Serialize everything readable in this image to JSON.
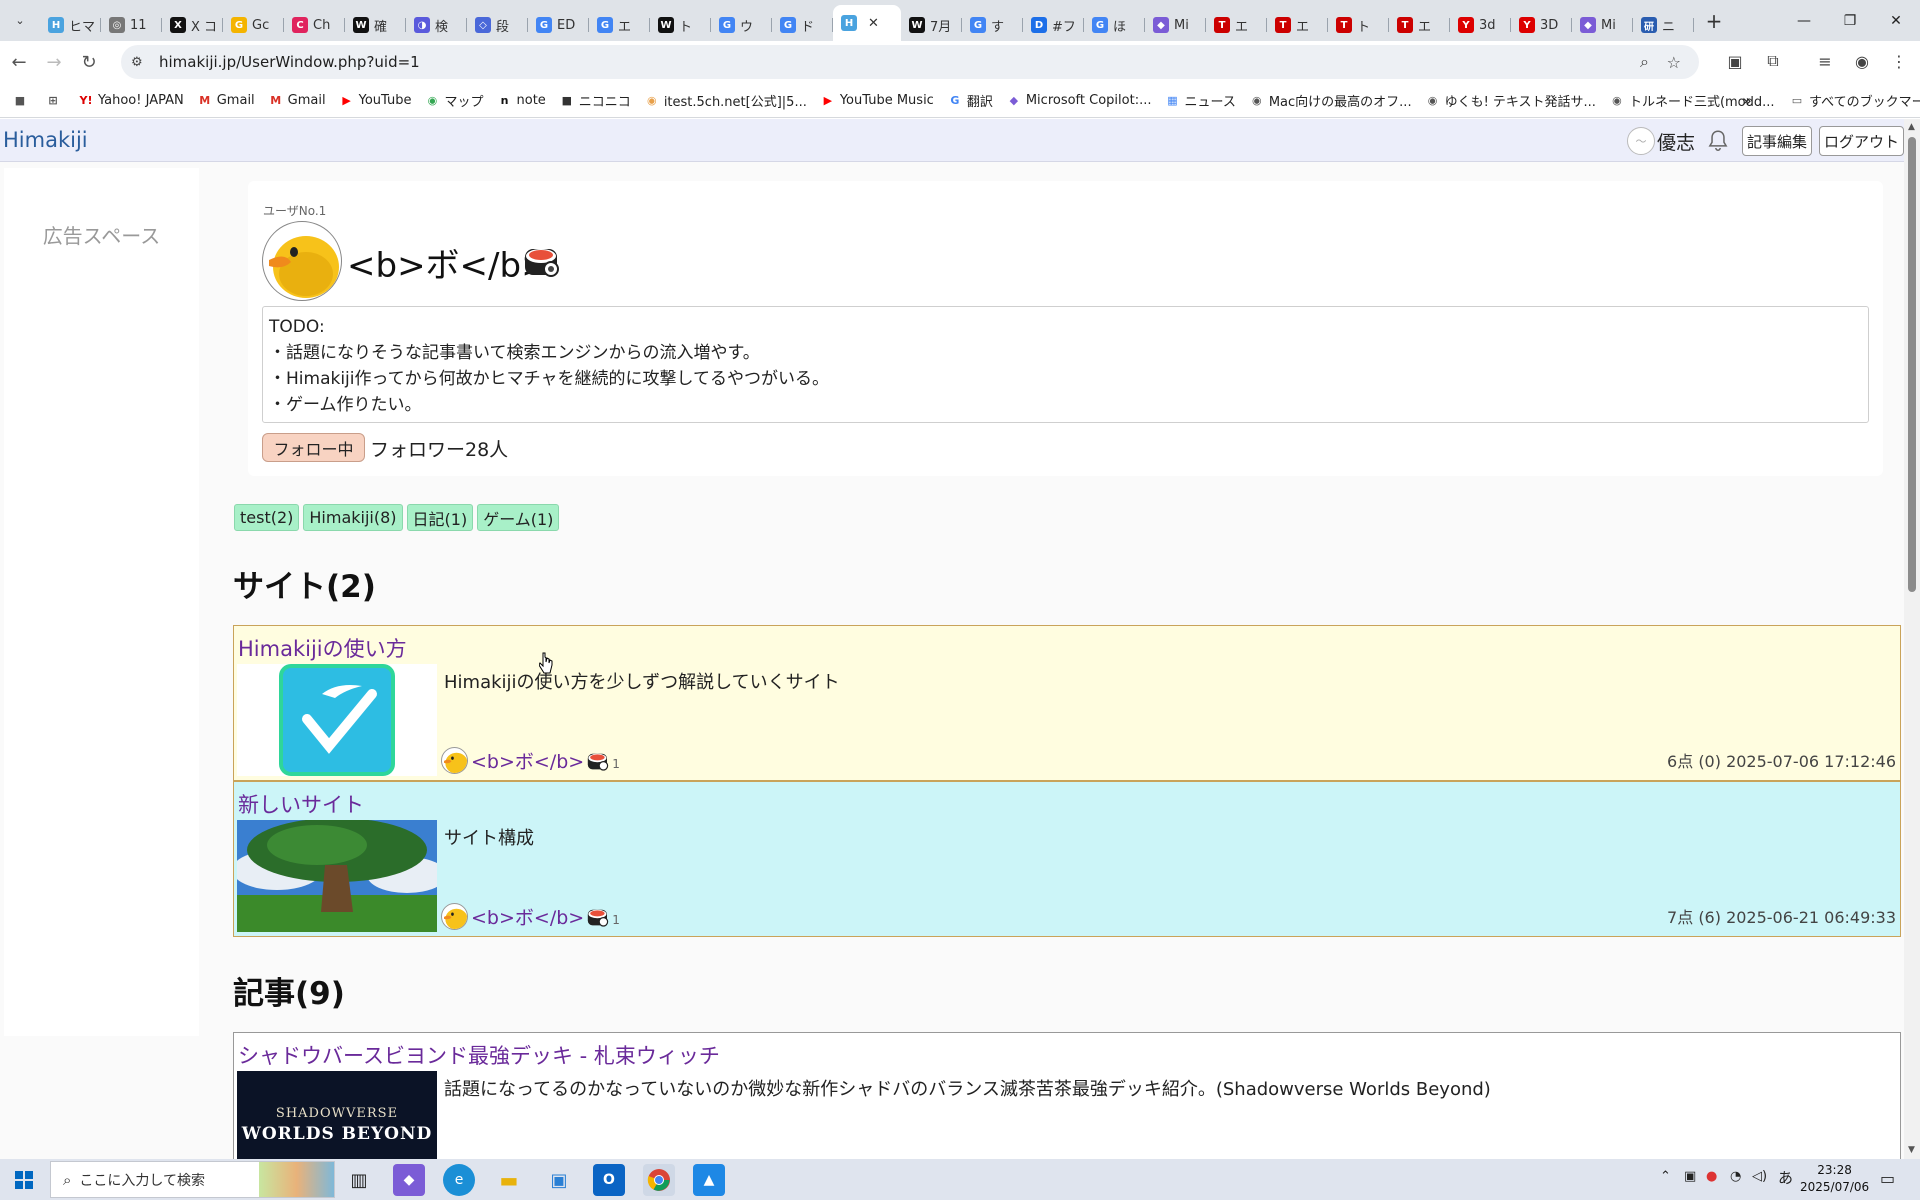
{
  "browser": {
    "tabs": [
      {
        "label": "ヒマ",
        "color": "#4aa3df",
        "glyph": "H"
      },
      {
        "label": "11",
        "color": "#777",
        "glyph": "◎"
      },
      {
        "label": "X コ",
        "color": "#111",
        "glyph": "X"
      },
      {
        "label": "Gc",
        "color": "#f4b400",
        "glyph": "G"
      },
      {
        "label": "Ch",
        "color": "#e0245e",
        "glyph": "C"
      },
      {
        "label": "確",
        "color": "#111",
        "glyph": "W"
      },
      {
        "label": "検",
        "color": "#5a5adc",
        "glyph": "◑"
      },
      {
        "label": "段",
        "color": "#4a68d9",
        "glyph": "◇"
      },
      {
        "label": "ED",
        "color": "#4285f4",
        "glyph": "G"
      },
      {
        "label": "エ",
        "color": "#4285f4",
        "glyph": "G"
      },
      {
        "label": "ト",
        "color": "#111",
        "glyph": "W"
      },
      {
        "label": "ウ",
        "color": "#4285f4",
        "glyph": "G"
      },
      {
        "label": "ド",
        "color": "#4285f4",
        "glyph": "G"
      },
      {
        "label": "",
        "color": "#4aa3df",
        "glyph": "H",
        "active": true
      },
      {
        "label": "7月",
        "color": "#111",
        "glyph": "W"
      },
      {
        "label": "す",
        "color": "#4285f4",
        "glyph": "G"
      },
      {
        "label": "#フ",
        "color": "#1d6fe8",
        "glyph": "D"
      },
      {
        "label": "ほ",
        "color": "#4285f4",
        "glyph": "G"
      },
      {
        "label": "Mi",
        "color": "#7b5cd6",
        "glyph": "◆"
      },
      {
        "label": "エ",
        "color": "#c00",
        "glyph": "T"
      },
      {
        "label": "エ",
        "color": "#c00",
        "glyph": "T"
      },
      {
        "label": "ト",
        "color": "#c00",
        "glyph": "T"
      },
      {
        "label": "エ",
        "color": "#c00",
        "glyph": "T"
      },
      {
        "label": "3d",
        "color": "#d00",
        "glyph": "Y"
      },
      {
        "label": "3D",
        "color": "#d00",
        "glyph": "Y"
      },
      {
        "label": "Mi",
        "color": "#7b5cd6",
        "glyph": "◆"
      },
      {
        "label": "ニ",
        "color": "#2a5db0",
        "glyph": "研"
      }
    ],
    "url": "himakiji.jp/UserWindow.php?uid=1",
    "bookmarks": [
      {
        "label": "Yahoo! JAPAN",
        "icon": "Y!",
        "color": "#d00"
      },
      {
        "label": "Gmail",
        "icon": "M",
        "color": "#d93025"
      },
      {
        "label": "Gmail",
        "icon": "M",
        "color": "#d93025"
      },
      {
        "label": "YouTube",
        "icon": "▶",
        "color": "#f00"
      },
      {
        "label": "マップ",
        "icon": "◉",
        "color": "#34a853"
      },
      {
        "label": "note",
        "icon": "n",
        "color": "#111"
      },
      {
        "label": "ニコニコ",
        "icon": "■",
        "color": "#333"
      },
      {
        "label": "itest.5ch.net[公式]|5...",
        "icon": "◉",
        "color": "#e8a04a"
      },
      {
        "label": "YouTube Music",
        "icon": "▶",
        "color": "#f00"
      },
      {
        "label": "翻訳",
        "icon": "G",
        "color": "#4285f4"
      },
      {
        "label": "Microsoft Copilot:...",
        "icon": "◆",
        "color": "#7b5cd6"
      },
      {
        "label": "ニュース",
        "icon": "▦",
        "color": "#4285f4"
      },
      {
        "label": "Mac向けの最高のオフ...",
        "icon": "◉",
        "color": "#555"
      },
      {
        "label": "ゆくも! テキスト発話サ...",
        "icon": "◉",
        "color": "#555"
      },
      {
        "label": "トルネード三式(modd...",
        "icon": "◉",
        "color": "#555"
      }
    ],
    "all_bookmarks": "すべてのブックマーク"
  },
  "site": {
    "logo": "Himakiji",
    "header_user": "優志",
    "edit_button": "記事編集",
    "logout_button": "ログアウト",
    "ad_space": "広告スペース"
  },
  "profile": {
    "user_no": "ユーザNo.1",
    "name": "<b>ボ</b>",
    "bio_lines": [
      "TODO:",
      "・話題になりそうな記事書いて検索エンジンからの流入増やす。",
      "・Himakiji作ってから何故かヒマチャを継続的に攻撃してるやつがいる。",
      "・ゲーム作りたい。"
    ],
    "follow_button": "フォロー中",
    "follower_count": "フォロワー28人"
  },
  "tags": [
    "test(2)",
    "Himakiji(8)",
    "日記(1)",
    "ゲーム(1)"
  ],
  "sections": {
    "sites_title": "サイト(2)",
    "articles_title": "記事(9)"
  },
  "sites": [
    {
      "title": "Himakijiの使い方",
      "description": "Himakijiの使い方を少しずつ解説していくサイト",
      "author": "<b>ボ</b>",
      "author_count": "1",
      "meta": "6点 (0) 2025-07-06 17:12:46",
      "bg": "#fffde0"
    },
    {
      "title": "新しいサイト",
      "description": "サイト構成",
      "author": "<b>ボ</b>",
      "author_count": "1",
      "meta": "7点 (6) 2025-06-21 06:49:33",
      "bg": "#ccf5f8"
    }
  ],
  "articles": [
    {
      "title": "シャドウバースビヨンド最強デッキ - 札束ウィッチ",
      "description": "話題になってるのかなっていないのか微妙な新作シャドバのバランス滅茶苦茶最強デッキ紹介。(Shadowverse Worlds Beyond)",
      "thumb_line1": "SHADOWVERSE",
      "thumb_line2": "WORLDS BEYOND"
    }
  ],
  "taskbar": {
    "search_placeholder": "ここに入力して検索",
    "time": "23:28",
    "date": "2025/07/06",
    "ime": "あ"
  }
}
